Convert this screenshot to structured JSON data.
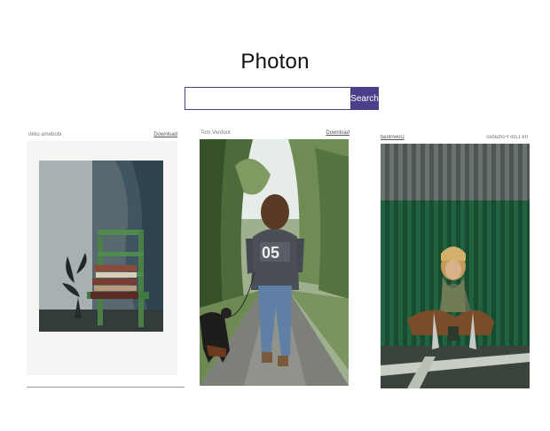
{
  "app": {
    "title": "Photon"
  },
  "search": {
    "value": "",
    "placeholder": "",
    "button_label": "Search"
  },
  "photos": [
    {
      "author": "rikko amebobi",
      "download_label": "Download",
      "subject": "polaroid of a chair with books and a plant"
    },
    {
      "author": "Tom Verdoot",
      "download_label": "Download",
      "subject": "person in a 05 hoodie walking a dog on a forest road"
    },
    {
      "author": "Ire Lolo Forbabes",
      "download_label": "Download",
      "subject": "person squatting in front of a green corrugated wall"
    }
  ],
  "colors": {
    "accent": "#4b3f8a",
    "background": "#ffffff",
    "caption_text": "#7a7a7a"
  }
}
